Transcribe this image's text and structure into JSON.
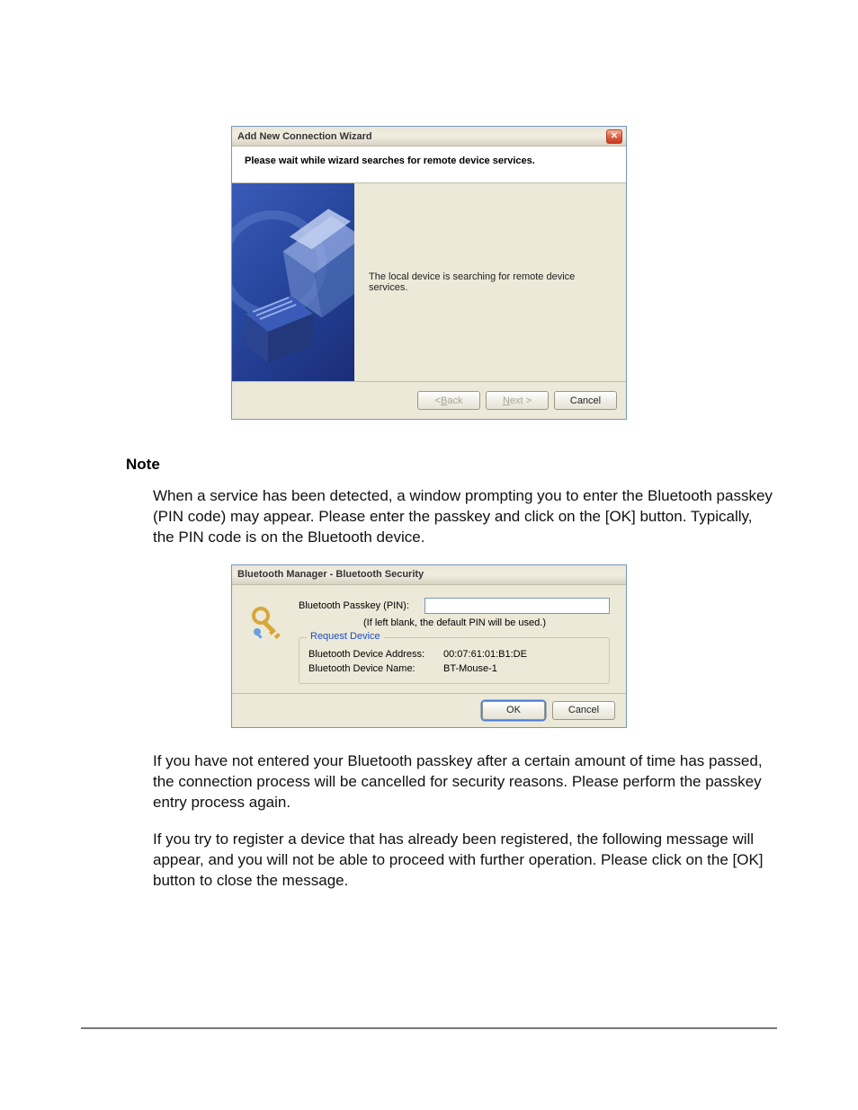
{
  "dialog1": {
    "title": "Add New Connection Wizard",
    "close_glyph": "✕",
    "subheader": "Please wait while wizard searches for remote device services.",
    "message": "The local device is searching for remote device services.",
    "back_prefix": "< ",
    "back_u": "B",
    "back_rest": "ack",
    "next_u": "N",
    "next_rest": "ext >",
    "cancel": "Cancel"
  },
  "note_heading": "Note",
  "para1": "When a service has been detected, a window prompting you to enter the Bluetooth passkey (PIN code) may appear. Please enter the passkey and click on the [OK] button. Typically, the PIN code is on the Bluetooth device.",
  "dialog2": {
    "title": "Bluetooth Manager - Bluetooth Security",
    "passkey_label": "Bluetooth Passkey (PIN):",
    "hint": "(If left blank, the default PIN will be used.)",
    "legend": "Request Device",
    "addr_label": "Bluetooth Device Address:",
    "addr_value": "00:07:61:01:B1:DE",
    "name_label": "Bluetooth Device Name:",
    "name_value": "BT-Mouse-1",
    "ok": "OK",
    "cancel": "Cancel"
  },
  "para2": "If you have not entered your Bluetooth passkey after a certain amount of time has passed, the connection process will be cancelled for security reasons. Please perform the passkey entry process again.",
  "para3": "If you try to register a device that has already been registered, the following message will appear, and you will not be able to proceed with further operation. Please click on the [OK] button to close the message."
}
